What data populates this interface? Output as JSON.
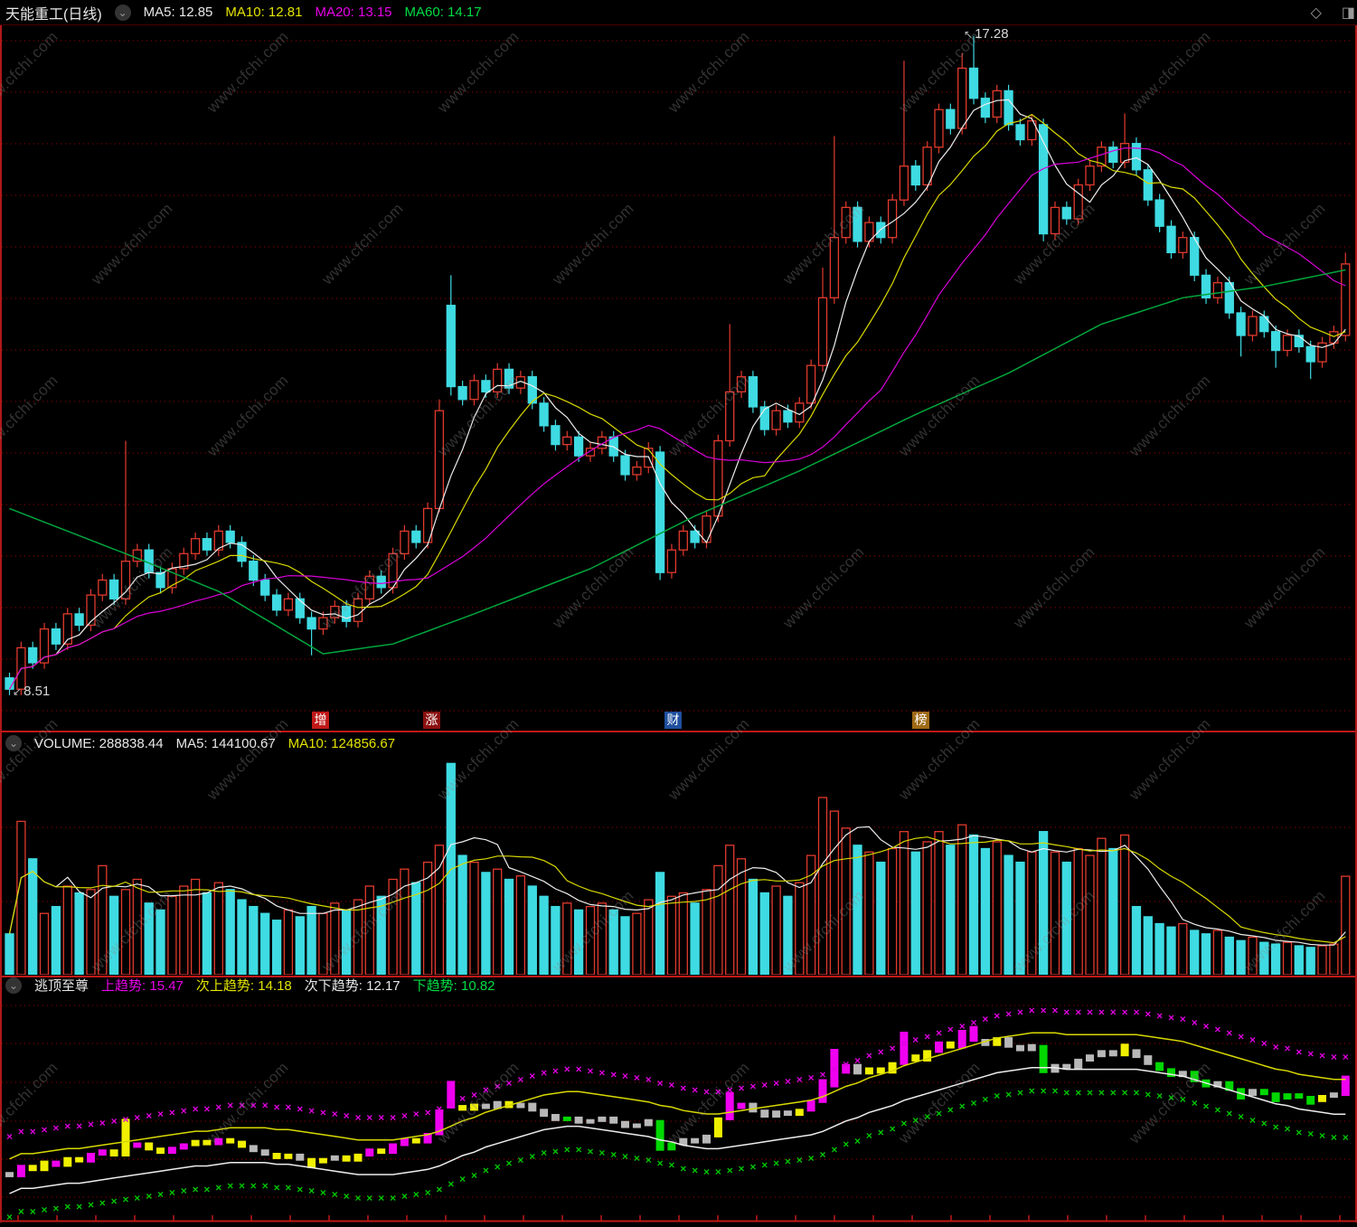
{
  "header": {
    "title": "天能重工(日线)",
    "ma5": "MA5: 12.85",
    "ma10": "MA10: 12.81",
    "ma20": "MA20: 13.15",
    "ma60": "MA60: 14.17"
  },
  "volume_header": {
    "volume": "VOLUME: 288838.44",
    "ma5": "MA5: 144100.67",
    "ma10": "MA10: 124856.67"
  },
  "indicator_header": {
    "name": "逃顶至尊",
    "up": "上趋势: 15.47",
    "sub_up": "次上趋势: 14.18",
    "sub_down": "次下趋势: 12.17",
    "down": "下趋势: 10.82"
  },
  "price_labels": {
    "high": "17.28",
    "low": "8.51"
  },
  "badges": [
    {
      "text": "增",
      "color": "#c01818"
    },
    {
      "text": "涨",
      "color": "#8a1010"
    },
    {
      "text": "财",
      "color": "#1e4f9e"
    },
    {
      "text": "榜",
      "color": "#9e6a16"
    }
  ],
  "icons": {
    "chevron": "⌄",
    "diamond": "◇",
    "window": "◨",
    "arrow_high": "↖",
    "arrow_low": "↙"
  },
  "watermark": {
    "text": "www.cfchi.com"
  },
  "colors": {
    "up": "#e23a2e",
    "down": "#3fdbe2",
    "ma5": "#ededed",
    "ma10": "#d8d800",
    "ma20": "#d800d8",
    "ma60": "#00a63c",
    "grid": "#a30000",
    "separator": "#c01818",
    "bar_yellow": "#f0f000",
    "bar_magenta": "#f000f0",
    "bar_gray": "#b8b8b8",
    "bar_green": "#00d800",
    "upper_x": "#e000e0",
    "lower_x": "#00c800"
  },
  "chart_data": [
    {
      "id": "price",
      "type": "candlestick",
      "title": "天能重工(日线)",
      "ylim": [
        8.03,
        17.42
      ],
      "annotations": [
        {
          "text": "17.28",
          "value": 17.28,
          "index": 83
        },
        {
          "text": "8.51",
          "value": 8.51,
          "index": 0
        }
      ],
      "ma60_anchors": [
        [
          0,
          11.0
        ],
        [
          10,
          10.4
        ],
        [
          18,
          9.9
        ],
        [
          27,
          9.07
        ],
        [
          33,
          9.2
        ],
        [
          40,
          9.6
        ],
        [
          50,
          10.2
        ],
        [
          59,
          10.9
        ],
        [
          68,
          11.5
        ],
        [
          78,
          12.25
        ],
        [
          86,
          12.8
        ],
        [
          94,
          13.45
        ],
        [
          101,
          13.8
        ],
        [
          108,
          13.95
        ],
        [
          115,
          14.17
        ]
      ],
      "ohlc": [
        [
          8.75,
          8.82,
          8.52,
          8.6
        ],
        [
          8.6,
          9.23,
          8.52,
          9.15
        ],
        [
          9.15,
          9.23,
          8.87,
          8.95
        ],
        [
          8.95,
          9.48,
          8.87,
          9.4
        ],
        [
          9.4,
          9.48,
          9.12,
          9.2
        ],
        [
          9.2,
          9.68,
          9.12,
          9.6
        ],
        [
          9.6,
          9.68,
          9.37,
          9.45
        ],
        [
          9.45,
          9.93,
          9.37,
          9.85
        ],
        [
          9.85,
          10.13,
          9.77,
          10.05
        ],
        [
          10.05,
          10.13,
          9.72,
          9.8
        ],
        [
          9.8,
          11.9,
          9.72,
          10.3
        ],
        [
          10.3,
          10.53,
          10.22,
          10.45
        ],
        [
          10.45,
          10.53,
          10.07,
          10.15
        ],
        [
          10.15,
          10.23,
          9.87,
          9.95
        ],
        [
          9.95,
          10.28,
          9.87,
          10.2
        ],
        [
          10.2,
          10.48,
          10.12,
          10.4
        ],
        [
          10.4,
          10.68,
          10.32,
          10.6
        ],
        [
          10.6,
          10.68,
          10.37,
          10.45
        ],
        [
          10.45,
          10.78,
          10.37,
          10.7
        ],
        [
          10.7,
          10.78,
          10.47,
          10.55
        ],
        [
          10.55,
          10.63,
          10.22,
          10.3
        ],
        [
          10.3,
          10.38,
          9.97,
          10.05
        ],
        [
          10.05,
          10.13,
          9.77,
          9.85
        ],
        [
          9.85,
          9.93,
          9.57,
          9.65
        ],
        [
          9.65,
          9.88,
          9.57,
          9.8
        ],
        [
          9.8,
          9.88,
          9.47,
          9.55
        ],
        [
          9.55,
          9.63,
          9.05,
          9.4
        ],
        [
          9.4,
          9.63,
          9.32,
          9.55
        ],
        [
          9.55,
          9.78,
          9.47,
          9.7
        ],
        [
          9.7,
          9.78,
          9.42,
          9.5
        ],
        [
          9.5,
          9.88,
          9.42,
          9.8
        ],
        [
          9.8,
          10.18,
          9.72,
          10.1
        ],
        [
          10.1,
          10.18,
          9.87,
          9.95
        ],
        [
          9.95,
          10.48,
          9.87,
          10.4
        ],
        [
          10.4,
          10.78,
          10.32,
          10.7
        ],
        [
          10.7,
          10.78,
          10.47,
          10.55
        ],
        [
          10.55,
          11.08,
          10.47,
          11.0
        ],
        [
          11.0,
          12.45,
          10.95,
          12.3
        ],
        [
          13.7,
          14.1,
          12.5,
          12.62
        ],
        [
          12.62,
          12.7,
          12.37,
          12.45
        ],
        [
          12.45,
          12.78,
          12.37,
          12.7
        ],
        [
          12.7,
          12.78,
          12.47,
          12.55
        ],
        [
          12.55,
          12.93,
          12.47,
          12.85
        ],
        [
          12.85,
          12.93,
          12.52,
          12.6
        ],
        [
          12.6,
          12.83,
          12.52,
          12.75
        ],
        [
          12.75,
          12.83,
          12.32,
          12.4
        ],
        [
          12.4,
          12.48,
          12.02,
          12.1
        ],
        [
          12.1,
          12.18,
          11.77,
          11.85
        ],
        [
          11.85,
          12.03,
          11.77,
          11.95
        ],
        [
          11.95,
          12.03,
          11.62,
          11.7
        ],
        [
          11.7,
          11.88,
          11.62,
          11.8
        ],
        [
          11.8,
          12.03,
          11.72,
          11.95
        ],
        [
          11.95,
          12.03,
          11.62,
          11.7
        ],
        [
          11.7,
          11.78,
          11.37,
          11.45
        ],
        [
          11.45,
          11.63,
          11.37,
          11.55
        ],
        [
          11.55,
          11.88,
          11.47,
          11.8
        ],
        [
          11.75,
          11.83,
          10.05,
          10.15
        ],
        [
          10.15,
          10.53,
          10.07,
          10.45
        ],
        [
          10.45,
          10.78,
          10.37,
          10.7
        ],
        [
          10.7,
          10.78,
          10.47,
          10.55
        ],
        [
          10.55,
          10.98,
          10.47,
          10.9
        ],
        [
          10.9,
          11.98,
          10.82,
          11.9
        ],
        [
          11.9,
          13.45,
          11.82,
          12.55
        ],
        [
          12.55,
          12.83,
          12.47,
          12.75
        ],
        [
          12.75,
          12.83,
          12.27,
          12.35
        ],
        [
          12.35,
          12.43,
          11.97,
          12.05
        ],
        [
          12.05,
          12.38,
          11.97,
          12.3
        ],
        [
          12.3,
          12.38,
          12.07,
          12.15
        ],
        [
          12.15,
          12.48,
          12.07,
          12.4
        ],
        [
          12.4,
          12.98,
          12.32,
          12.9
        ],
        [
          12.9,
          14.2,
          12.82,
          13.8
        ],
        [
          13.8,
          15.95,
          13.72,
          14.6
        ],
        [
          14.6,
          15.08,
          14.52,
          15.0
        ],
        [
          15.0,
          15.08,
          14.47,
          14.55
        ],
        [
          14.55,
          14.88,
          14.47,
          14.8
        ],
        [
          14.8,
          14.88,
          14.52,
          14.6
        ],
        [
          14.6,
          15.18,
          14.52,
          15.1
        ],
        [
          15.1,
          16.95,
          15.02,
          15.55
        ],
        [
          15.55,
          15.63,
          15.22,
          15.3
        ],
        [
          15.3,
          15.88,
          15.22,
          15.8
        ],
        [
          15.8,
          16.38,
          15.72,
          16.3
        ],
        [
          16.3,
          16.38,
          15.97,
          16.05
        ],
        [
          16.05,
          17.05,
          15.97,
          16.85
        ],
        [
          16.85,
          17.28,
          16.37,
          16.45
        ],
        [
          16.45,
          16.53,
          16.12,
          16.2
        ],
        [
          16.2,
          16.63,
          16.12,
          16.55
        ],
        [
          16.55,
          16.63,
          16.02,
          16.1
        ],
        [
          16.1,
          16.18,
          15.82,
          15.9
        ],
        [
          15.9,
          16.23,
          15.82,
          16.15
        ],
        [
          16.1,
          16.18,
          14.55,
          14.65
        ],
        [
          14.65,
          15.08,
          14.57,
          15.0
        ],
        [
          15.0,
          15.08,
          14.77,
          14.85
        ],
        [
          14.85,
          15.38,
          14.77,
          15.3
        ],
        [
          15.3,
          15.63,
          15.22,
          15.55
        ],
        [
          15.55,
          15.88,
          15.47,
          15.8
        ],
        [
          15.8,
          15.88,
          15.52,
          15.6
        ],
        [
          15.6,
          16.25,
          15.52,
          15.85
        ],
        [
          15.85,
          15.93,
          15.42,
          15.5
        ],
        [
          15.5,
          15.58,
          15.02,
          15.1
        ],
        [
          15.1,
          15.18,
          14.67,
          14.75
        ],
        [
          14.75,
          14.83,
          14.32,
          14.4
        ],
        [
          14.4,
          14.68,
          14.32,
          14.6
        ],
        [
          14.6,
          14.68,
          14.02,
          14.1
        ],
        [
          14.1,
          14.18,
          13.72,
          13.8
        ],
        [
          13.8,
          14.08,
          13.72,
          14.0
        ],
        [
          14.0,
          14.08,
          13.52,
          13.6
        ],
        [
          13.6,
          13.68,
          13.02,
          13.3
        ],
        [
          13.3,
          13.63,
          13.22,
          13.55
        ],
        [
          13.55,
          13.63,
          13.27,
          13.35
        ],
        [
          13.35,
          13.43,
          12.87,
          13.1
        ],
        [
          13.1,
          13.38,
          13.02,
          13.3
        ],
        [
          13.3,
          13.38,
          13.07,
          13.15
        ],
        [
          13.15,
          13.23,
          12.72,
          12.95
        ],
        [
          12.95,
          13.28,
          12.87,
          13.2
        ],
        [
          13.2,
          13.43,
          13.12,
          13.35
        ],
        [
          13.3,
          14.4,
          13.22,
          14.25
        ]
      ]
    },
    {
      "id": "volume",
      "type": "bar",
      "ymax": 650000,
      "current": 288838.44,
      "values": [
        120000,
        450000,
        340000,
        180000,
        200000,
        260000,
        240000,
        250000,
        320000,
        230000,
        250000,
        280000,
        210000,
        190000,
        230000,
        260000,
        280000,
        240000,
        270000,
        250000,
        220000,
        200000,
        180000,
        160000,
        190000,
        170000,
        200000,
        180000,
        210000,
        190000,
        220000,
        260000,
        230000,
        280000,
        310000,
        270000,
        330000,
        380000,
        620000,
        350000,
        330000,
        300000,
        310000,
        280000,
        290000,
        260000,
        230000,
        200000,
        210000,
        190000,
        200000,
        210000,
        190000,
        170000,
        180000,
        220000,
        300000,
        230000,
        240000,
        210000,
        250000,
        320000,
        380000,
        340000,
        280000,
        240000,
        260000,
        230000,
        270000,
        350000,
        520000,
        480000,
        430000,
        380000,
        360000,
        330000,
        370000,
        420000,
        360000,
        390000,
        420000,
        380000,
        440000,
        410000,
        370000,
        390000,
        350000,
        330000,
        360000,
        420000,
        360000,
        330000,
        370000,
        350000,
        400000,
        370000,
        410000,
        200000,
        170000,
        150000,
        140000,
        150000,
        130000,
        120000,
        130000,
        110000,
        100000,
        110000,
        95000,
        90000,
        95000,
        85000,
        80000,
        85000,
        90000,
        288838
      ]
    },
    {
      "id": "trend",
      "type": "custom",
      "name": "逃顶至尊",
      "ylim": [
        6.0,
        19.2
      ],
      "current": {
        "upper": 15.47,
        "mid_upper": 14.18,
        "mid_lower": 12.17,
        "lower": 10.82
      },
      "offsets": {
        "upper": 2.27,
        "mid_upper": 0.98,
        "mid_lower": -1.03,
        "lower": -2.38
      },
      "base": [
        8.6,
        8.9,
        8.9,
        9.0,
        9.1,
        9.2,
        9.2,
        9.3,
        9.4,
        9.5,
        9.6,
        9.7,
        9.8,
        9.9,
        10.0,
        10.1,
        10.2,
        10.2,
        10.3,
        10.4,
        10.4,
        10.4,
        10.4,
        10.3,
        10.3,
        10.2,
        10.1,
        10.0,
        9.9,
        9.8,
        9.7,
        9.7,
        9.7,
        9.7,
        9.8,
        9.9,
        10.0,
        10.2,
        10.5,
        10.8,
        11.0,
        11.3,
        11.5,
        11.7,
        11.9,
        12.1,
        12.3,
        12.4,
        12.5,
        12.5,
        12.4,
        12.3,
        12.2,
        12.1,
        12.0,
        11.9,
        11.7,
        11.6,
        11.4,
        11.3,
        11.2,
        11.2,
        11.3,
        11.4,
        11.5,
        11.6,
        11.7,
        11.8,
        11.9,
        12.0,
        12.2,
        12.5,
        12.8,
        13.0,
        13.3,
        13.5,
        13.7,
        14.0,
        14.2,
        14.4,
        14.6,
        14.8,
        15.0,
        15.2,
        15.4,
        15.6,
        15.7,
        15.8,
        15.9,
        15.9,
        15.9,
        15.8,
        15.8,
        15.8,
        15.8,
        15.8,
        15.8,
        15.8,
        15.7,
        15.6,
        15.5,
        15.4,
        15.2,
        15.0,
        14.8,
        14.6,
        14.4,
        14.2,
        14.0,
        13.8,
        13.7,
        13.5,
        13.4,
        13.3,
        13.2,
        13.2
      ],
      "bar_colors": "wmyymyymmyymyymmyymyywwyywyywyymymmymmmyywwywwwwgwwwwwwwggwwwymmwwwwymmmmwyyymyymymmwywwwgwwwwwwywwggwggwggwgggggywm"
    }
  ]
}
